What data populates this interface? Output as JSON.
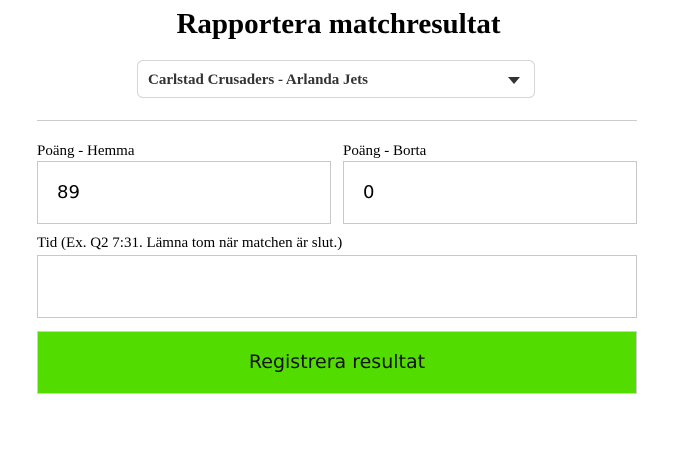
{
  "page": {
    "title": "Rapportera matchresultat"
  },
  "match_select": {
    "selected_value": "Carlstad Crusaders - Arlanda Jets",
    "icon": "chevron-down-icon"
  },
  "form": {
    "home_score": {
      "label": "Poäng - Hemma",
      "value": "89"
    },
    "away_score": {
      "label": "Poäng - Borta",
      "value": "0"
    },
    "time": {
      "label": "Tid (Ex. Q2 7:31. Lämna tom när matchen är slut.)",
      "value": ""
    },
    "submit_label": "Registrera resultat"
  },
  "colors": {
    "submit_background": "#52dc00",
    "border": "#c8c8c8",
    "divider": "#cccccc"
  }
}
